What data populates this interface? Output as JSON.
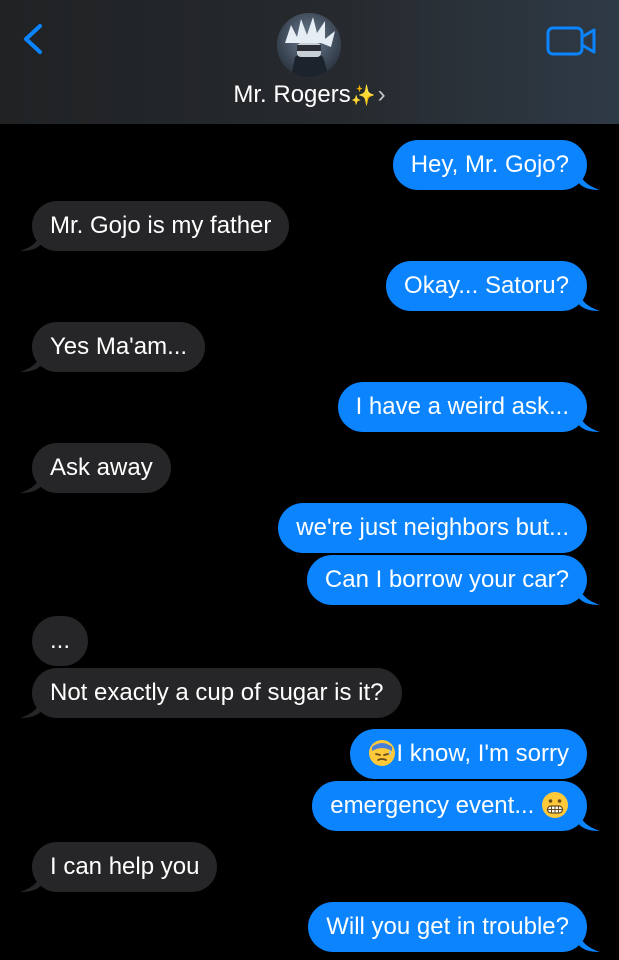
{
  "header": {
    "contact_name": "Mr. Rogers",
    "name_suffix_emoji": "✨",
    "chevron": "›",
    "back_icon": "chevron-left-icon",
    "video_icon": "video-camera-icon",
    "accent_color": "#0b84fe"
  },
  "colors": {
    "background": "#000000",
    "incoming_bubble": "#262628",
    "outgoing_bubble": "#0b84fe"
  },
  "messages": [
    {
      "from": "me",
      "text": "Hey, Mr. Gojo?"
    },
    {
      "from": "them",
      "text": "Mr. Gojo is my father"
    },
    {
      "from": "me",
      "text": "Okay... Satoru?"
    },
    {
      "from": "them",
      "text": "Yes Ma'am..."
    },
    {
      "from": "me",
      "text": "I have a weird ask..."
    },
    {
      "from": "them",
      "text": "Ask away"
    },
    {
      "from": "me",
      "text": "we're just neighbors but..."
    },
    {
      "from": "me",
      "text": "Can I borrow your car?"
    },
    {
      "from": "them",
      "text": "..."
    },
    {
      "from": "them",
      "text": "Not exactly a cup of sugar is it?"
    },
    {
      "from": "me",
      "text": "I know, I'm sorry",
      "emoji": "downcast-sweat-face"
    },
    {
      "from": "me",
      "text": "emergency event... ",
      "emoji": "grimacing-face"
    },
    {
      "from": "them",
      "text": "I can help you"
    },
    {
      "from": "me",
      "text": "Will you get in trouble?"
    }
  ]
}
